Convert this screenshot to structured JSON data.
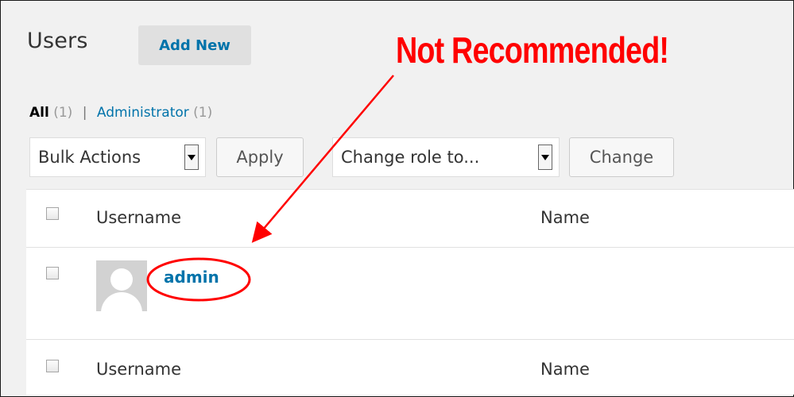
{
  "page": {
    "title": "Users",
    "add_new": "Add New"
  },
  "filters": {
    "all_label": "All",
    "all_count": "(1)",
    "separator": "|",
    "admin_label": "Administrator",
    "admin_count": "(1)"
  },
  "toolbar": {
    "bulk_actions": "Bulk Actions",
    "apply": "Apply",
    "change_role": "Change role to...",
    "change": "Change"
  },
  "table": {
    "header": {
      "username": "Username",
      "name": "Name"
    },
    "rows": [
      {
        "username": "admin",
        "name": ""
      }
    ],
    "footer": {
      "username": "Username",
      "name": "Name"
    }
  },
  "annotation": {
    "text": "Not Recommended!",
    "color": "#ff0000"
  },
  "colors": {
    "link": "#0073aa",
    "background": "#f1f1f1"
  }
}
